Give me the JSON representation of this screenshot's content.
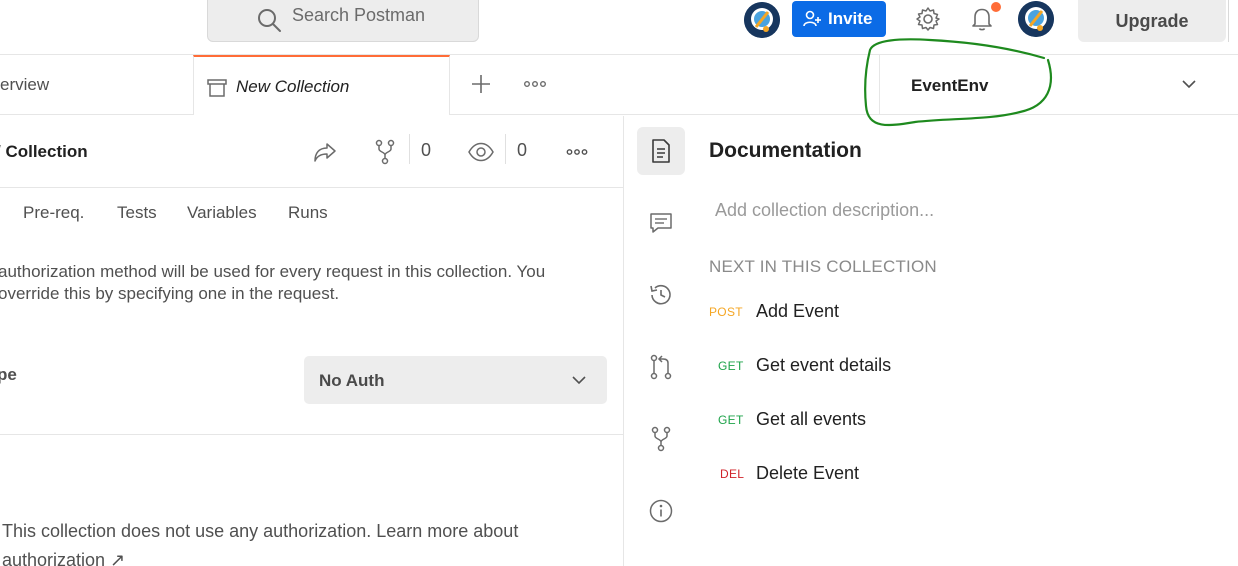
{
  "header": {
    "search_placeholder": "Search Postman",
    "invite_label": "Invite",
    "upgrade_label": "Upgrade",
    "notification_dot_color": "#ff6c37",
    "invite_color": "#0b6be6"
  },
  "tabs": {
    "overview_label": "erview",
    "active_label": "New Collection",
    "active_accent": "#ff6c37"
  },
  "environment": {
    "selected": "EventEnv",
    "annotation_color": "#1e8a1e"
  },
  "collection": {
    "title": "/ Collection",
    "fork_count": "0",
    "watch_count": "0",
    "subtabs": [
      "Pre-req.",
      "Tests",
      "Variables",
      "Runs"
    ],
    "auth_description_line1": "authorization method will be used for every request in this collection. You",
    "auth_description_line2": "override this by specifying one in the request.",
    "type_label": "pe",
    "auth_type": "No Auth",
    "noauth_text": "This collection does not use any authorization. Learn more about",
    "learn_more_link": "authorization ↗"
  },
  "docs": {
    "title": "Documentation",
    "description_placeholder": "Add collection description...",
    "next_title": "NEXT IN THIS COLLECTION",
    "requests": [
      {
        "method": "POST",
        "name": "Add Event",
        "color": "#f5a623"
      },
      {
        "method": "GET",
        "name": "Get event details",
        "color": "#1ea34a"
      },
      {
        "method": "GET",
        "name": "Get all events",
        "color": "#1ea34a"
      },
      {
        "method": "DEL",
        "name": "Delete Event",
        "color": "#d0232a"
      }
    ]
  }
}
